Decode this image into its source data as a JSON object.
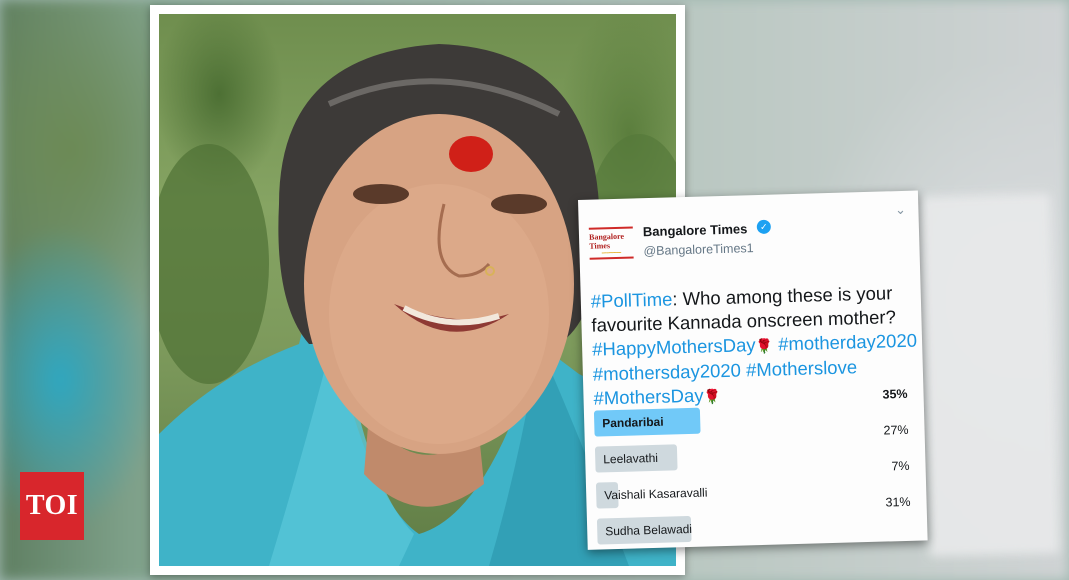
{
  "branding": {
    "toi_logo_text": "TOI",
    "logo_color": "#d8262c"
  },
  "tweet": {
    "account_logo_text": "Bangalore Times",
    "account_name": "Bangalore Times",
    "account_handle": "@BangaloreTimes1",
    "verified_icon": "check-badge-icon",
    "text_parts": {
      "hashtag_polltime": "#PollTime",
      "question": ": Who among these is your favourite Kannada onscreen mother?",
      "hashtag_happy": "#HappyMothersDay",
      "hashtag_motherday2020": "#motherday2020",
      "hashtag_mothersday2020": "#mothersday2020",
      "hashtag_motherslove": "#Motherslove",
      "hashtag_mothersday": "#MothersDay"
    },
    "link_color": "#1b95e0"
  },
  "poll": {
    "options": [
      {
        "label": "Pandaribai",
        "percent_text": "35%",
        "percent": 35,
        "winner": true
      },
      {
        "label": "Leelavathi",
        "percent_text": "27%",
        "percent": 27,
        "winner": false
      },
      {
        "label": "Vaishali Kasaravalli",
        "percent_text": "7%",
        "percent": 7,
        "winner": false
      },
      {
        "label": "Sudha Belawadi",
        "percent_text": "31%",
        "percent": 31,
        "winner": false
      }
    ],
    "winner_color": "#71c9f8",
    "other_color": "#cfd9de"
  }
}
